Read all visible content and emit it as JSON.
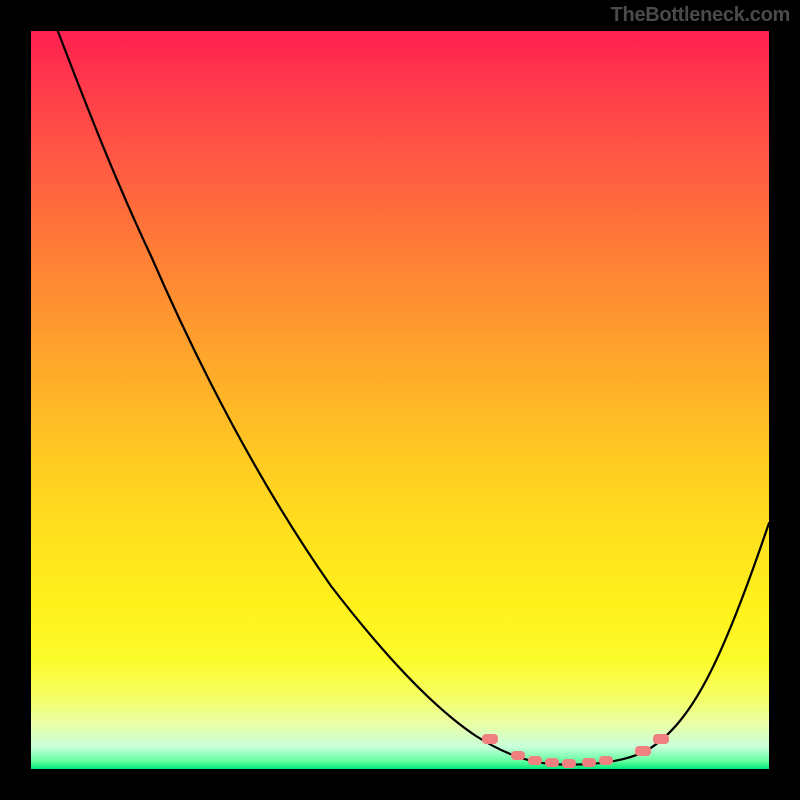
{
  "attribution": "TheBottleneck.com",
  "colors": {
    "page_bg": "#000000",
    "gradient_top": "#ff2050",
    "gradient_mid": "#ffe01e",
    "gradient_bottom": "#00e878",
    "curve": "#000000",
    "markers": "#f08080",
    "attribution_text": "#4a4a4a"
  },
  "chart_data": {
    "type": "line",
    "title": "",
    "xlabel": "",
    "ylabel": "",
    "x": [
      0.035,
      0.068,
      0.108,
      0.163,
      0.23,
      0.312,
      0.407,
      0.474,
      0.541,
      0.603,
      0.67,
      0.738,
      0.8,
      0.833,
      0.867,
      0.894,
      0.921,
      0.948,
      1.0
    ],
    "values": [
      1.003,
      0.919,
      0.81,
      0.695,
      0.539,
      0.384,
      0.248,
      0.16,
      0.085,
      0.045,
      0.023,
      0.01,
      0.005,
      0.024,
      0.045,
      0.079,
      0.133,
      0.188,
      0.333
    ],
    "markers_x": [
      0.611,
      0.65,
      0.674,
      0.697,
      0.72,
      0.747,
      0.77,
      0.819,
      0.843
    ],
    "markers_y": [
      0.047,
      0.024,
      0.018,
      0.015,
      0.014,
      0.015,
      0.018,
      0.031,
      0.047
    ],
    "xlim": [
      0,
      1
    ],
    "ylim": [
      0,
      1
    ],
    "notes": "Axes unlabeled in source; x/y are normalized fractions of the plot area (x left→right, y bottom→top). Curve descends from top-left, reaches a minimum near x≈0.74, then rises toward the right edge. Pink markers cluster around the trough. Background gradient encodes y (red=top→green=bottom)."
  }
}
